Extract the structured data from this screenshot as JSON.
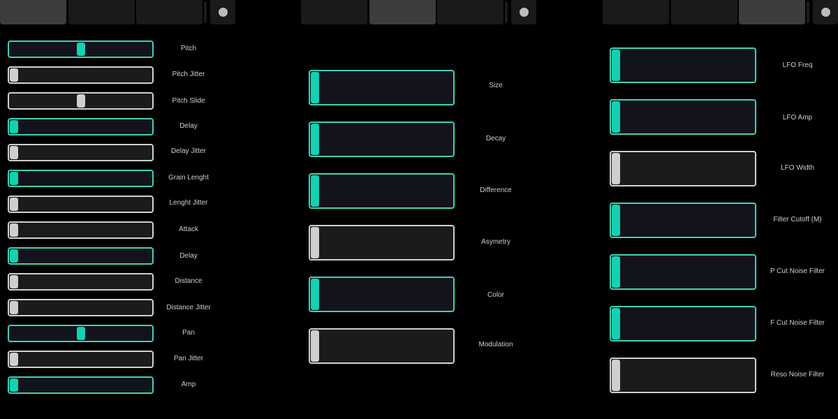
{
  "colors": {
    "accent": "#12d2b3",
    "active_border": "#3fd2b4",
    "inactive": "#d0d0d0",
    "background": "#000000"
  },
  "tab_bars": [
    {
      "tabs": [
        {
          "label": "",
          "active": true
        },
        {
          "label": "",
          "active": false
        },
        {
          "label": "",
          "active": false
        }
      ],
      "button_icon": "circle-icon"
    },
    {
      "tabs": [
        {
          "label": "",
          "active": false
        },
        {
          "label": "",
          "active": true
        },
        {
          "label": "",
          "active": false
        }
      ],
      "button_icon": "circle-icon"
    },
    {
      "tabs": [
        {
          "label": "",
          "active": false
        },
        {
          "label": "",
          "active": false
        },
        {
          "label": "",
          "active": true
        }
      ],
      "button_icon": "circle-icon"
    }
  ],
  "panels": [
    {
      "sliders": [
        {
          "label": "Pitch",
          "value": 0.5,
          "active": true
        },
        {
          "label": "Pitch Jitter",
          "value": 0,
          "active": false
        },
        {
          "label": "Pitch Slide",
          "value": 0.5,
          "active": false
        },
        {
          "label": "Delay",
          "value": 0,
          "active": true
        },
        {
          "label": "Delay Jitter",
          "value": 0,
          "active": false
        },
        {
          "label": "Grain Lenght",
          "value": 0,
          "active": true
        },
        {
          "label": "Lenght Jitter",
          "value": 0,
          "active": false
        },
        {
          "label": "Attack",
          "value": 0,
          "active": false
        },
        {
          "label": "Delay",
          "value": 0,
          "active": true
        },
        {
          "label": "Distance",
          "value": 0,
          "active": false
        },
        {
          "label": "Distance Jitter",
          "value": 0,
          "active": false
        },
        {
          "label": "Pan",
          "value": 0.5,
          "active": true
        },
        {
          "label": "Pan Jitter",
          "value": 0,
          "active": false
        },
        {
          "label": "Amp",
          "value": 0,
          "active": true
        }
      ]
    },
    {
      "sliders": [
        {
          "label": "Size",
          "value": 0,
          "active": true
        },
        {
          "label": "Decay",
          "value": 0,
          "active": true
        },
        {
          "label": "Difference",
          "value": 0,
          "active": true
        },
        {
          "label": "Asymetry",
          "value": 0,
          "active": false
        },
        {
          "label": "Color",
          "value": 0,
          "active": true
        },
        {
          "label": "Modulation",
          "value": 0,
          "active": false
        }
      ]
    },
    {
      "sliders": [
        {
          "label": "LFO Freq",
          "value": 0,
          "active": true
        },
        {
          "label": "LFO Amp",
          "value": 0,
          "active": true
        },
        {
          "label": "LFO Width",
          "value": 0,
          "active": false
        },
        {
          "label": "Filter Cutoff (M)",
          "value": 0,
          "active": true
        },
        {
          "label": "P Cut Noise Filter",
          "value": 0,
          "active": true
        },
        {
          "label": "F Cut Noise Filter",
          "value": 0,
          "active": true
        },
        {
          "label": "Reso Noise Filter",
          "value": 0,
          "active": false
        }
      ]
    }
  ]
}
